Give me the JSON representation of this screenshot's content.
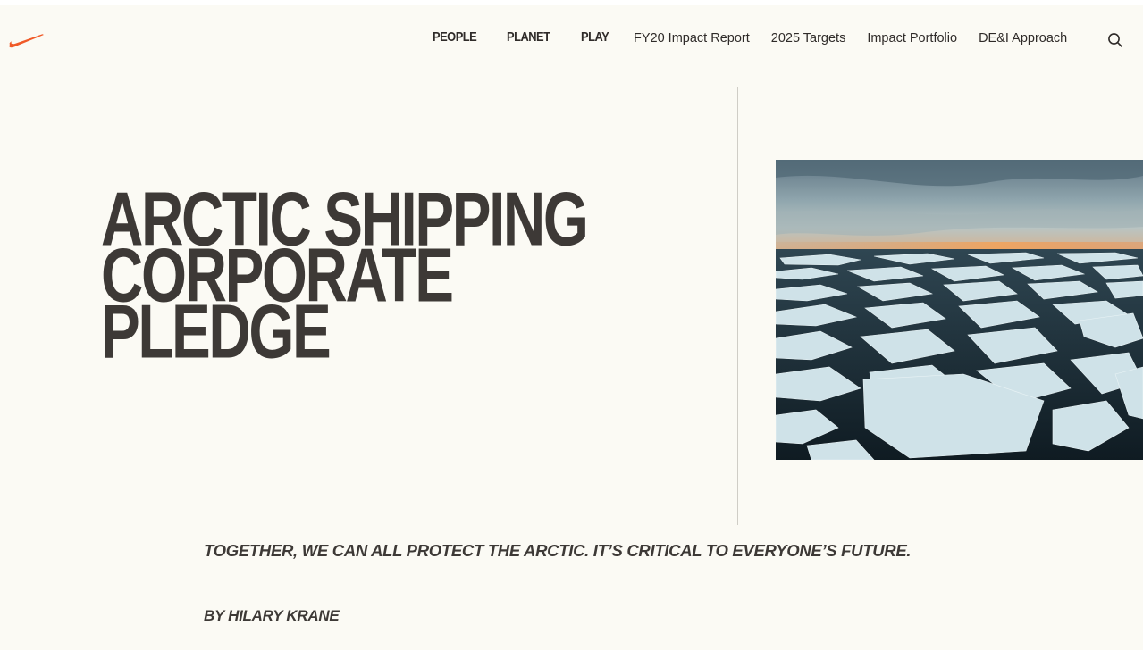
{
  "header": {
    "logo_icon": "swoosh-icon",
    "brand_color": "#f05a28",
    "primary_nav": [
      {
        "label": "PEOPLE"
      },
      {
        "label": "PLANET"
      },
      {
        "label": "PLAY"
      }
    ],
    "secondary_nav": [
      {
        "label": "FY20 Impact Report"
      },
      {
        "label": "2025 Targets"
      },
      {
        "label": "Impact Portfolio"
      },
      {
        "label": "DE&I Approach"
      }
    ],
    "search_icon": "search-icon"
  },
  "article": {
    "title_lines": [
      "ARCTIC SHIPPING",
      "CORPORATE",
      "PLEDGE"
    ],
    "subhead": "TOGETHER, WE CAN ALL PROTECT THE ARCTIC. IT’S CRITICAL TO EVERYONE’S FUTURE.",
    "byline": "BY HILARY KRANE"
  },
  "colors": {
    "background": "#fbfaf4",
    "text": "#3d3936"
  }
}
